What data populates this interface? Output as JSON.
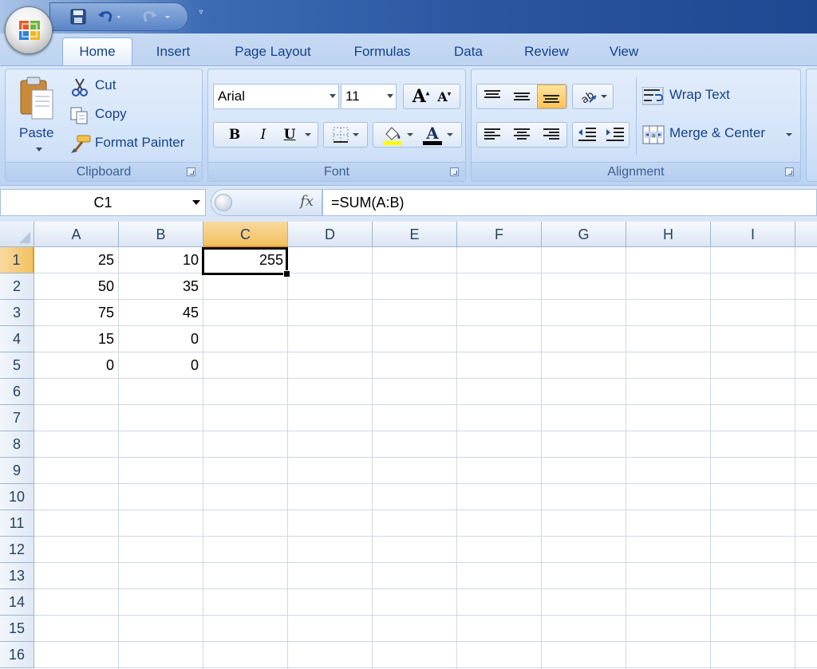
{
  "tabs": [
    {
      "label": "Home",
      "active": true
    },
    {
      "label": "Insert"
    },
    {
      "label": "Page Layout"
    },
    {
      "label": "Formulas"
    },
    {
      "label": "Data"
    },
    {
      "label": "Review"
    },
    {
      "label": "View"
    }
  ],
  "clipboard": {
    "group_label": "Clipboard",
    "paste": "Paste",
    "cut": "Cut",
    "copy": "Copy",
    "format_painter": "Format Painter"
  },
  "font": {
    "group_label": "Font",
    "name": "Arial",
    "size": "11",
    "bold": "B",
    "italic": "I",
    "underline": "U"
  },
  "alignment": {
    "group_label": "Alignment",
    "wrap_text": "Wrap Text",
    "merge_center": "Merge & Center"
  },
  "formula_bar": {
    "name_box": "C1",
    "fx": "fx",
    "formula": "=SUM(A:B)"
  },
  "sheet": {
    "columns": [
      "A",
      "B",
      "C",
      "D",
      "E",
      "F",
      "G",
      "H",
      "I"
    ],
    "rows": [
      "1",
      "2",
      "3",
      "4",
      "5",
      "6",
      "7",
      "8",
      "9",
      "10",
      "11",
      "12",
      "13",
      "14",
      "15",
      "16"
    ],
    "selected_cell": "C1",
    "cells": {
      "A1": "25",
      "B1": "10",
      "C1": "255",
      "A2": "50",
      "B2": "35",
      "A3": "75",
      "B3": "45",
      "A4": "15",
      "B4": "0",
      "A5": "0",
      "B5": "0"
    }
  },
  "colors": {
    "accent": "#15428b",
    "selection_header": "#f1c15f",
    "grid_line": "#d0d7e5",
    "highlight_button": "#ffc35a"
  },
  "icons": [
    "office-button-icon",
    "save-icon",
    "undo-icon",
    "redo-icon",
    "customize-qat-icon",
    "paste-icon",
    "cut-icon",
    "copy-icon",
    "format-painter-icon",
    "grow-font-icon",
    "shrink-font-icon",
    "border-icon",
    "fill-color-icon",
    "font-color-icon",
    "align-top-icon",
    "align-middle-icon",
    "align-bottom-icon",
    "orientation-icon",
    "align-left-icon",
    "align-center-icon",
    "align-right-icon",
    "decrease-indent-icon",
    "increase-indent-icon",
    "wrap-text-icon",
    "merge-center-icon",
    "fx-icon"
  ]
}
